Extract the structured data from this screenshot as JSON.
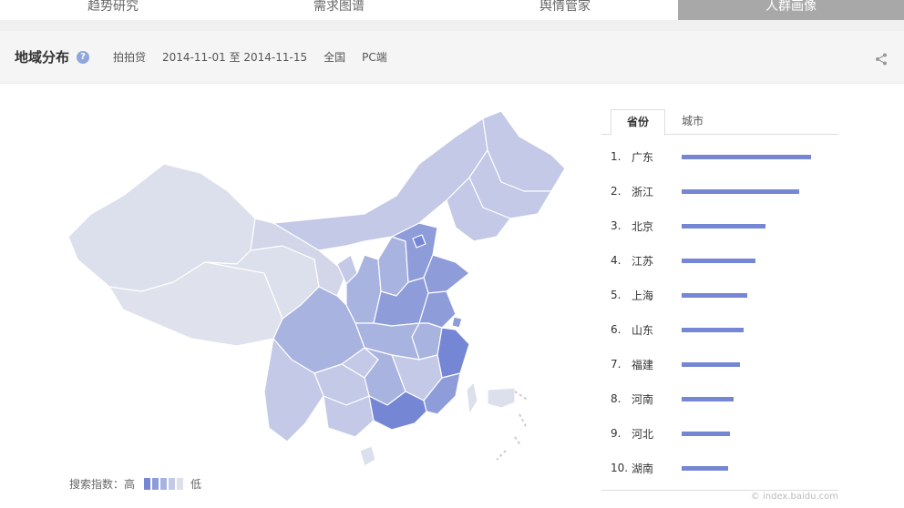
{
  "tabs": [
    {
      "label": "趋势研究"
    },
    {
      "label": "需求图谱"
    },
    {
      "label": "舆情管家"
    },
    {
      "label": "人群画像"
    }
  ],
  "header": {
    "title": "地域分布",
    "help_glyph": "?",
    "keyword": "拍拍贷",
    "date_range": "2014-11-01 至 2014-11-15",
    "region": "全国",
    "platform": "PC端"
  },
  "legend": {
    "label": "搜索指数：高",
    "low": "低",
    "colors": [
      "#7587d4",
      "#8e9dd9",
      "#a9b3e0",
      "#c3c9e6",
      "#dcdfec"
    ]
  },
  "ranking": {
    "tabs": [
      {
        "label": "省份"
      },
      {
        "label": "城市"
      }
    ],
    "active_tab": "省份",
    "items": [
      {
        "rank": "1.",
        "name": "广东",
        "value": 100
      },
      {
        "rank": "2.",
        "name": "浙江",
        "value": 91
      },
      {
        "rank": "3.",
        "name": "北京",
        "value": 65
      },
      {
        "rank": "4.",
        "name": "江苏",
        "value": 57
      },
      {
        "rank": "5.",
        "name": "上海",
        "value": 51
      },
      {
        "rank": "6.",
        "name": "山东",
        "value": 48
      },
      {
        "rank": "7.",
        "name": "福建",
        "value": 45
      },
      {
        "rank": "8.",
        "name": "河南",
        "value": 40
      },
      {
        "rank": "9.",
        "name": "河北",
        "value": 37
      },
      {
        "rank": "10.",
        "name": "湖南",
        "value": 36
      }
    ]
  },
  "watermark": "© index.baidu.com"
}
